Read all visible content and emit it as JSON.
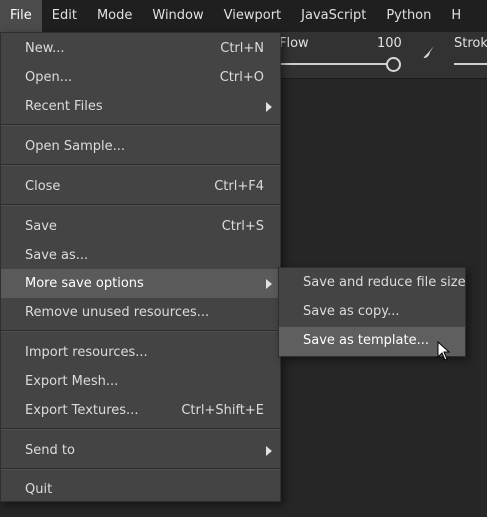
{
  "menubar": {
    "items": [
      {
        "label": "File"
      },
      {
        "label": "Edit"
      },
      {
        "label": "Mode"
      },
      {
        "label": "Window"
      },
      {
        "label": "Viewport"
      },
      {
        "label": "JavaScript"
      },
      {
        "label": "Python"
      },
      {
        "label": "H"
      }
    ]
  },
  "toolbar": {
    "flow_label": "Flow",
    "flow_value": "100",
    "flow_level_percent": 100,
    "stroke_label": "Stroke"
  },
  "file_menu": {
    "items": [
      {
        "label": "New...",
        "shortcut": "Ctrl+N"
      },
      {
        "label": "Open...",
        "shortcut": "Ctrl+O"
      },
      {
        "label": "Recent Files",
        "shortcut": ""
      },
      {
        "label": "Open Sample...",
        "shortcut": ""
      },
      {
        "label": "Close",
        "shortcut": "Ctrl+F4"
      },
      {
        "label": "Save",
        "shortcut": "Ctrl+S"
      },
      {
        "label": "Save as...",
        "shortcut": ""
      },
      {
        "label": "More save options",
        "shortcut": ""
      },
      {
        "label": "Remove unused resources...",
        "shortcut": ""
      },
      {
        "label": "Import resources...",
        "shortcut": ""
      },
      {
        "label": "Export Mesh...",
        "shortcut": ""
      },
      {
        "label": "Export Textures...",
        "shortcut": "Ctrl+Shift+E"
      },
      {
        "label": "Send to",
        "shortcut": ""
      },
      {
        "label": "Quit",
        "shortcut": ""
      }
    ]
  },
  "save_submenu": {
    "items": [
      {
        "label": "Save and reduce file size"
      },
      {
        "label": "Save as copy..."
      },
      {
        "label": "Save as template..."
      }
    ]
  }
}
